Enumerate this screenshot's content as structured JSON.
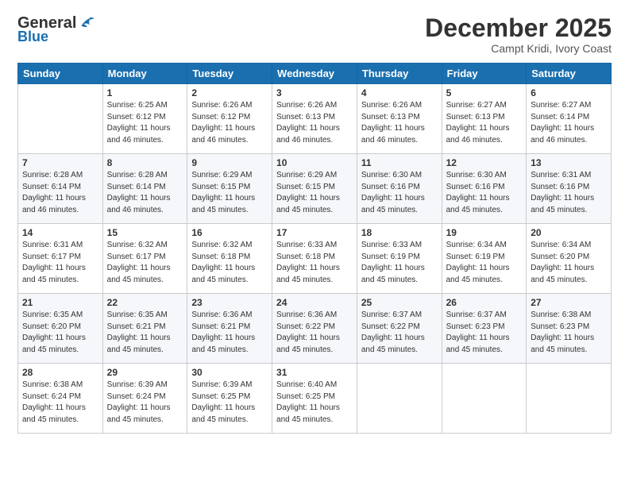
{
  "logo": {
    "general": "General",
    "blue": "Blue"
  },
  "title": "December 2025",
  "location": "Campt Kridi, Ivory Coast",
  "headers": [
    "Sunday",
    "Monday",
    "Tuesday",
    "Wednesday",
    "Thursday",
    "Friday",
    "Saturday"
  ],
  "weeks": [
    [
      {
        "day": "",
        "info": ""
      },
      {
        "day": "1",
        "info": "Sunrise: 6:25 AM\nSunset: 6:12 PM\nDaylight: 11 hours\nand 46 minutes."
      },
      {
        "day": "2",
        "info": "Sunrise: 6:26 AM\nSunset: 6:12 PM\nDaylight: 11 hours\nand 46 minutes."
      },
      {
        "day": "3",
        "info": "Sunrise: 6:26 AM\nSunset: 6:13 PM\nDaylight: 11 hours\nand 46 minutes."
      },
      {
        "day": "4",
        "info": "Sunrise: 6:26 AM\nSunset: 6:13 PM\nDaylight: 11 hours\nand 46 minutes."
      },
      {
        "day": "5",
        "info": "Sunrise: 6:27 AM\nSunset: 6:13 PM\nDaylight: 11 hours\nand 46 minutes."
      },
      {
        "day": "6",
        "info": "Sunrise: 6:27 AM\nSunset: 6:14 PM\nDaylight: 11 hours\nand 46 minutes."
      }
    ],
    [
      {
        "day": "7",
        "info": "Sunrise: 6:28 AM\nSunset: 6:14 PM\nDaylight: 11 hours\nand 46 minutes."
      },
      {
        "day": "8",
        "info": "Sunrise: 6:28 AM\nSunset: 6:14 PM\nDaylight: 11 hours\nand 46 minutes."
      },
      {
        "day": "9",
        "info": "Sunrise: 6:29 AM\nSunset: 6:15 PM\nDaylight: 11 hours\nand 45 minutes."
      },
      {
        "day": "10",
        "info": "Sunrise: 6:29 AM\nSunset: 6:15 PM\nDaylight: 11 hours\nand 45 minutes."
      },
      {
        "day": "11",
        "info": "Sunrise: 6:30 AM\nSunset: 6:16 PM\nDaylight: 11 hours\nand 45 minutes."
      },
      {
        "day": "12",
        "info": "Sunrise: 6:30 AM\nSunset: 6:16 PM\nDaylight: 11 hours\nand 45 minutes."
      },
      {
        "day": "13",
        "info": "Sunrise: 6:31 AM\nSunset: 6:16 PM\nDaylight: 11 hours\nand 45 minutes."
      }
    ],
    [
      {
        "day": "14",
        "info": "Sunrise: 6:31 AM\nSunset: 6:17 PM\nDaylight: 11 hours\nand 45 minutes."
      },
      {
        "day": "15",
        "info": "Sunrise: 6:32 AM\nSunset: 6:17 PM\nDaylight: 11 hours\nand 45 minutes."
      },
      {
        "day": "16",
        "info": "Sunrise: 6:32 AM\nSunset: 6:18 PM\nDaylight: 11 hours\nand 45 minutes."
      },
      {
        "day": "17",
        "info": "Sunrise: 6:33 AM\nSunset: 6:18 PM\nDaylight: 11 hours\nand 45 minutes."
      },
      {
        "day": "18",
        "info": "Sunrise: 6:33 AM\nSunset: 6:19 PM\nDaylight: 11 hours\nand 45 minutes."
      },
      {
        "day": "19",
        "info": "Sunrise: 6:34 AM\nSunset: 6:19 PM\nDaylight: 11 hours\nand 45 minutes."
      },
      {
        "day": "20",
        "info": "Sunrise: 6:34 AM\nSunset: 6:20 PM\nDaylight: 11 hours\nand 45 minutes."
      }
    ],
    [
      {
        "day": "21",
        "info": "Sunrise: 6:35 AM\nSunset: 6:20 PM\nDaylight: 11 hours\nand 45 minutes."
      },
      {
        "day": "22",
        "info": "Sunrise: 6:35 AM\nSunset: 6:21 PM\nDaylight: 11 hours\nand 45 minutes."
      },
      {
        "day": "23",
        "info": "Sunrise: 6:36 AM\nSunset: 6:21 PM\nDaylight: 11 hours\nand 45 minutes."
      },
      {
        "day": "24",
        "info": "Sunrise: 6:36 AM\nSunset: 6:22 PM\nDaylight: 11 hours\nand 45 minutes."
      },
      {
        "day": "25",
        "info": "Sunrise: 6:37 AM\nSunset: 6:22 PM\nDaylight: 11 hours\nand 45 minutes."
      },
      {
        "day": "26",
        "info": "Sunrise: 6:37 AM\nSunset: 6:23 PM\nDaylight: 11 hours\nand 45 minutes."
      },
      {
        "day": "27",
        "info": "Sunrise: 6:38 AM\nSunset: 6:23 PM\nDaylight: 11 hours\nand 45 minutes."
      }
    ],
    [
      {
        "day": "28",
        "info": "Sunrise: 6:38 AM\nSunset: 6:24 PM\nDaylight: 11 hours\nand 45 minutes."
      },
      {
        "day": "29",
        "info": "Sunrise: 6:39 AM\nSunset: 6:24 PM\nDaylight: 11 hours\nand 45 minutes."
      },
      {
        "day": "30",
        "info": "Sunrise: 6:39 AM\nSunset: 6:25 PM\nDaylight: 11 hours\nand 45 minutes."
      },
      {
        "day": "31",
        "info": "Sunrise: 6:40 AM\nSunset: 6:25 PM\nDaylight: 11 hours\nand 45 minutes."
      },
      {
        "day": "",
        "info": ""
      },
      {
        "day": "",
        "info": ""
      },
      {
        "day": "",
        "info": ""
      }
    ]
  ]
}
